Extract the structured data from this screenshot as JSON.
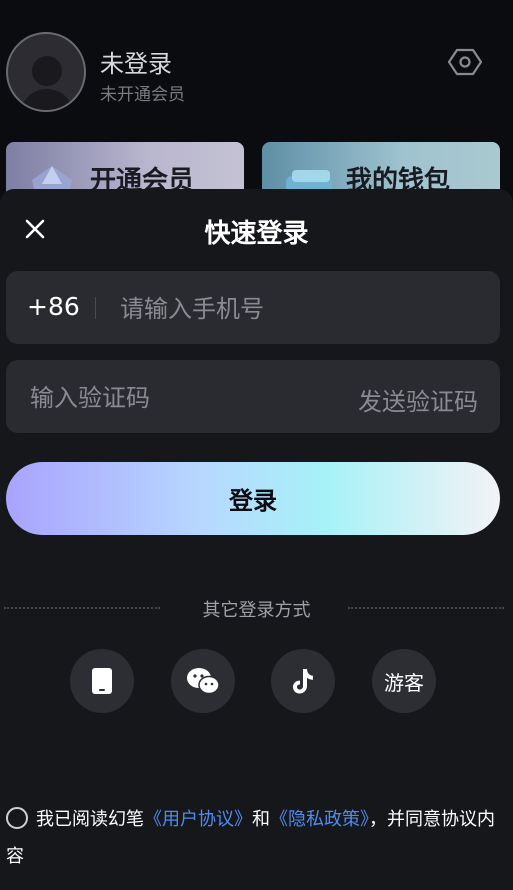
{
  "profile": {
    "name": "未登录",
    "membership_status": "未开通会员",
    "cards": [
      {
        "label": "开通会员"
      },
      {
        "label": "我的钱包"
      }
    ]
  },
  "login_sheet": {
    "title": "快速登录",
    "phone": {
      "country_code": "+86",
      "placeholder": "请输入手机号",
      "value": ""
    },
    "code": {
      "placeholder": "输入验证码",
      "value": "",
      "send_label": "发送验证码"
    },
    "login_label": "登录",
    "other_methods_label": "其它登录方式",
    "alt_methods": [
      {
        "icon": "phone-icon"
      },
      {
        "icon": "wechat-icon"
      },
      {
        "icon": "tiktok-icon"
      },
      {
        "label": "游客"
      }
    ],
    "agreement": {
      "checked": false,
      "prefix": "我已阅读幻笔",
      "user_agreement": "《用户协议》",
      "and": "和",
      "privacy_policy": "《隐私政策》",
      "suffix": "，并同意协议内容"
    }
  },
  "colors": {
    "background": "#0b0c10",
    "sheet": "#16171b",
    "field": "#2a2b30",
    "link": "#4f8bf0",
    "login_gradient_start": "#a9a3ff",
    "login_gradient_end": "#f3f2f6"
  }
}
